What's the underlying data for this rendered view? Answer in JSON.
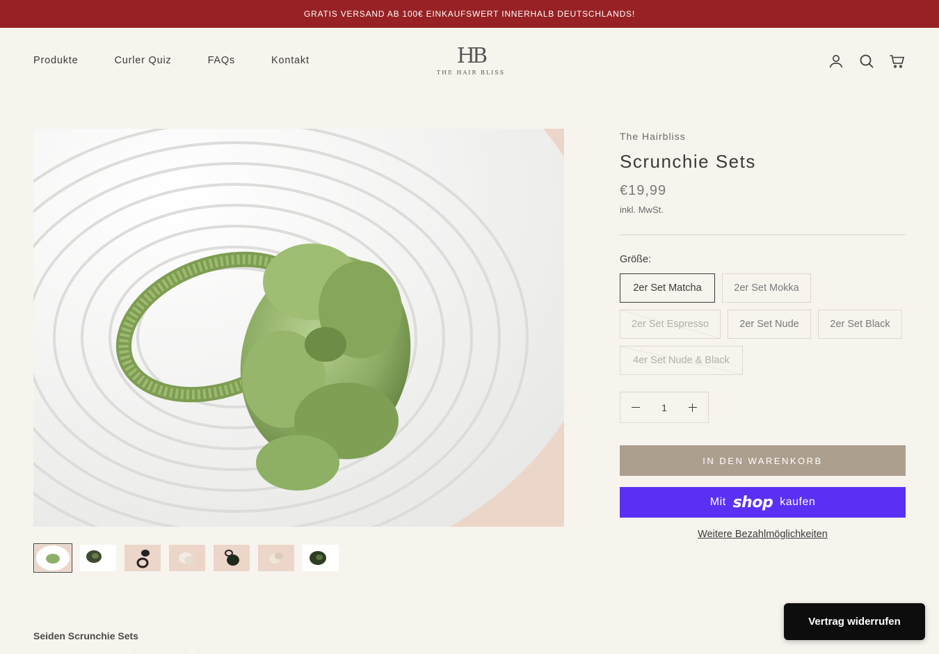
{
  "announcement": {
    "text": "GRATIS VERSAND AB 100€ EINKAUFSWERT INNERHALB DEUTSCHLANDS!"
  },
  "nav": {
    "items": [
      "Produkte",
      "Curler Quiz",
      "FAQs",
      "Kontakt"
    ]
  },
  "logo": {
    "mark": "HB",
    "text": "THE HAIR BLISS"
  },
  "product": {
    "vendor": "The Hairbliss",
    "title": "Scrunchie Sets",
    "price": "€19,99",
    "tax_note": "inkl. MwSt.",
    "size_label": "Größe:",
    "options": [
      {
        "label": "2er Set Matcha",
        "state": "selected"
      },
      {
        "label": "2er Set Mokka",
        "state": "available"
      },
      {
        "label": "2er Set Espresso",
        "state": "sold-out"
      },
      {
        "label": "2er Set Nude",
        "state": "available"
      },
      {
        "label": "2er Set Black",
        "state": "available"
      },
      {
        "label": "4er Set Nude & Black",
        "state": "sold-out"
      }
    ],
    "quantity": "1",
    "add_to_cart": "IN DEN WARENKORB",
    "shop_pay": {
      "prefix": "Mit",
      "brand": "shop",
      "suffix": "kaufen"
    },
    "more_payment": "Weitere Bezahlmöglichkeiten"
  },
  "section_title": "Seiden Scrunchie Sets",
  "widerruf_button": "Vertrag widerrufen",
  "colors": {
    "announcement_bg": "#972124",
    "page_bg": "#f7f4ee",
    "cart_button": "#ad9f8e",
    "shop_pay": "#5a31f4",
    "scrunchie_green": "#8fb06a"
  },
  "thumbnails": [
    "matcha-scrunchie",
    "dark-green-scrunchie",
    "black-hair-tie",
    "nude-scrunchie",
    "black-scrunchie",
    "nude-set",
    "green-scrunchie-dark"
  ]
}
